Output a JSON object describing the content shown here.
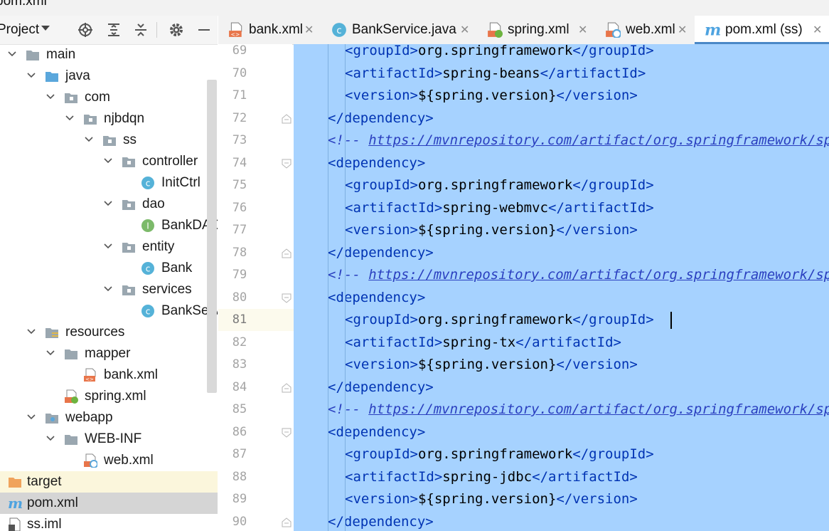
{
  "window": {
    "title": "pom.xml"
  },
  "project_panel": {
    "title": "Project",
    "toolbar_icons": [
      "locate-icon",
      "expand-all-icon",
      "collapse-all-icon",
      "gear-icon",
      "minimize-icon"
    ]
  },
  "tree": [
    {
      "label": "main",
      "icon": "folder",
      "level": 0,
      "chevron": "down"
    },
    {
      "label": "java",
      "icon": "source-folder",
      "level": 1,
      "chevron": "down"
    },
    {
      "label": "com",
      "icon": "package",
      "level": 2,
      "chevron": "down"
    },
    {
      "label": "njbdqn",
      "icon": "package",
      "level": 3,
      "chevron": "down"
    },
    {
      "label": "ss",
      "icon": "package",
      "level": 4,
      "chevron": "down"
    },
    {
      "label": "controller",
      "icon": "package",
      "level": 5,
      "chevron": "down"
    },
    {
      "label": "InitCtrl",
      "icon": "class",
      "level": 6,
      "chevron": "none"
    },
    {
      "label": "dao",
      "icon": "package",
      "level": 5,
      "chevron": "down"
    },
    {
      "label": "BankDAO",
      "icon": "interface",
      "level": 6,
      "chevron": "none"
    },
    {
      "label": "entity",
      "icon": "package",
      "level": 5,
      "chevron": "down"
    },
    {
      "label": "Bank",
      "icon": "class",
      "level": 6,
      "chevron": "none"
    },
    {
      "label": "services",
      "icon": "package",
      "level": 5,
      "chevron": "down"
    },
    {
      "label": "BankService",
      "icon": "class",
      "level": 6,
      "chevron": "none"
    },
    {
      "label": "resources",
      "icon": "resources-folder",
      "level": 1,
      "chevron": "down"
    },
    {
      "label": "mapper",
      "icon": "folder",
      "level": 2,
      "chevron": "down"
    },
    {
      "label": "bank.xml",
      "icon": "xml",
      "level": 3,
      "chevron": "none"
    },
    {
      "label": "spring.xml",
      "icon": "spring-xml",
      "level": 2,
      "chevron": "none"
    },
    {
      "label": "webapp",
      "icon": "web-folder",
      "level": 1,
      "chevron": "down"
    },
    {
      "label": "WEB-INF",
      "icon": "folder",
      "level": 2,
      "chevron": "down"
    },
    {
      "label": "web.xml",
      "icon": "web-xml",
      "level": 3,
      "chevron": "none"
    },
    {
      "label": "target",
      "icon": "excluded-folder",
      "level": -1,
      "chevron": "none",
      "state": "excluded"
    },
    {
      "label": "pom.xml",
      "icon": "maven",
      "level": -1,
      "chevron": "none",
      "state": "selected"
    },
    {
      "label": "ss.iml",
      "icon": "iml",
      "level": -1,
      "chevron": "none"
    }
  ],
  "tabs": [
    {
      "label": "bank.xml",
      "icon": "xml-icon",
      "active": false
    },
    {
      "label": "BankService.java",
      "icon": "class-icon",
      "active": false
    },
    {
      "label": "spring.xml",
      "icon": "spring-xml-icon",
      "active": false
    },
    {
      "label": "web.xml",
      "icon": "web-xml-icon",
      "active": false
    },
    {
      "label": "pom.xml (ss)",
      "icon": "maven-icon",
      "active": true
    }
  ],
  "editor": {
    "current_line": 81,
    "lines": [
      {
        "n": 69,
        "indent": 2,
        "parts": [
          [
            "tag",
            "<groupId>"
          ],
          [
            "txt",
            "org.springframework"
          ],
          [
            "tag",
            "</groupId>"
          ]
        ]
      },
      {
        "n": 70,
        "indent": 2,
        "parts": [
          [
            "tag",
            "<artifactId>"
          ],
          [
            "txt",
            "spring-beans"
          ],
          [
            "tag",
            "</artifactId>"
          ]
        ]
      },
      {
        "n": 71,
        "indent": 2,
        "parts": [
          [
            "tag",
            "<version>"
          ],
          [
            "txt",
            "${spring.version}"
          ],
          [
            "tag",
            "</version>"
          ]
        ]
      },
      {
        "n": 72,
        "indent": 1,
        "fold": "end",
        "parts": [
          [
            "tag",
            "</dependency>"
          ]
        ]
      },
      {
        "n": 73,
        "indent": 1,
        "parts": [
          [
            "cmt",
            "<!-- "
          ],
          [
            "url",
            "https://mvnrepository.com/artifact/org.springframework/spring-webmvc"
          ]
        ]
      },
      {
        "n": 74,
        "indent": 1,
        "fold": "start",
        "parts": [
          [
            "tag",
            "<dependency>"
          ]
        ]
      },
      {
        "n": 75,
        "indent": 2,
        "parts": [
          [
            "tag",
            "<groupId>"
          ],
          [
            "txt",
            "org.springframework"
          ],
          [
            "tag",
            "</groupId>"
          ]
        ]
      },
      {
        "n": 76,
        "indent": 2,
        "parts": [
          [
            "tag",
            "<artifactId>"
          ],
          [
            "txt",
            "spring-webmvc"
          ],
          [
            "tag",
            "</artifactId>"
          ]
        ]
      },
      {
        "n": 77,
        "indent": 2,
        "parts": [
          [
            "tag",
            "<version>"
          ],
          [
            "txt",
            "${spring.version}"
          ],
          [
            "tag",
            "</version>"
          ]
        ]
      },
      {
        "n": 78,
        "indent": 1,
        "fold": "end",
        "parts": [
          [
            "tag",
            "</dependency>"
          ]
        ]
      },
      {
        "n": 79,
        "indent": 1,
        "parts": [
          [
            "cmt",
            "<!-- "
          ],
          [
            "url",
            "https://mvnrepository.com/artifact/org.springframework/spring-tx"
          ]
        ]
      },
      {
        "n": 80,
        "indent": 1,
        "fold": "start",
        "parts": [
          [
            "tag",
            "<dependency>"
          ]
        ]
      },
      {
        "n": 81,
        "indent": 2,
        "caret": true,
        "parts": [
          [
            "tag",
            "<groupId>"
          ],
          [
            "txt",
            "org.springframework"
          ],
          [
            "tag",
            "</groupId>"
          ]
        ]
      },
      {
        "n": 82,
        "indent": 2,
        "parts": [
          [
            "tag",
            "<artifactId>"
          ],
          [
            "txt",
            "spring-tx"
          ],
          [
            "tag",
            "</artifactId>"
          ]
        ]
      },
      {
        "n": 83,
        "indent": 2,
        "parts": [
          [
            "tag",
            "<version>"
          ],
          [
            "txt",
            "${spring.version}"
          ],
          [
            "tag",
            "</version>"
          ]
        ]
      },
      {
        "n": 84,
        "indent": 1,
        "fold": "end",
        "parts": [
          [
            "tag",
            "</dependency>"
          ]
        ]
      },
      {
        "n": 85,
        "indent": 1,
        "parts": [
          [
            "cmt",
            "<!-- "
          ],
          [
            "url",
            "https://mvnrepository.com/artifact/org.springframework/spring-jdbc"
          ]
        ]
      },
      {
        "n": 86,
        "indent": 1,
        "fold": "start",
        "parts": [
          [
            "tag",
            "<dependency>"
          ]
        ]
      },
      {
        "n": 87,
        "indent": 2,
        "parts": [
          [
            "tag",
            "<groupId>"
          ],
          [
            "txt",
            "org.springframework"
          ],
          [
            "tag",
            "</groupId>"
          ]
        ]
      },
      {
        "n": 88,
        "indent": 2,
        "parts": [
          [
            "tag",
            "<artifactId>"
          ],
          [
            "txt",
            "spring-jdbc"
          ],
          [
            "tag",
            "</artifactId>"
          ]
        ]
      },
      {
        "n": 89,
        "indent": 2,
        "parts": [
          [
            "tag",
            "<version>"
          ],
          [
            "txt",
            "${spring.version}"
          ],
          [
            "tag",
            "</version>"
          ]
        ]
      },
      {
        "n": 90,
        "indent": 1,
        "fold": "end",
        "parts": [
          [
            "tag",
            "</dependency>"
          ]
        ]
      }
    ]
  },
  "colors": {
    "selection": "#a6d2ff",
    "tag": "#0033b3",
    "comment": "#2a3fbf",
    "active_tab_underline": "#4a88c7",
    "tree_selected": "#d5d5d5",
    "excluded_row": "#fbf6dc"
  }
}
